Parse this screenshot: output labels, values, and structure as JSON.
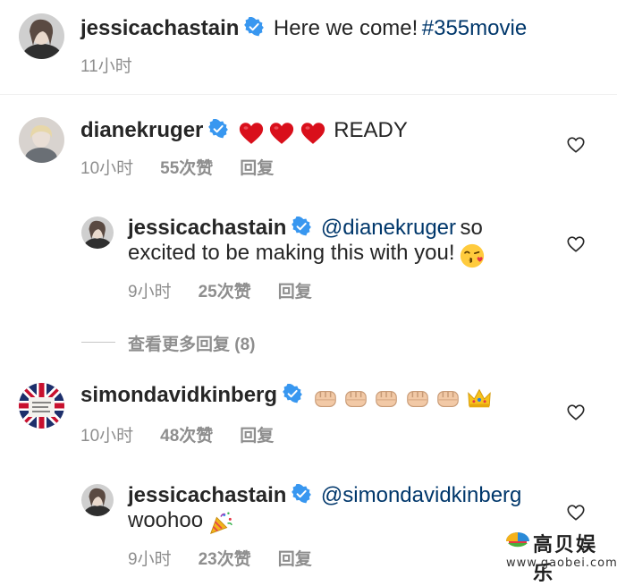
{
  "post": {
    "username": "jessicachastain",
    "caption": "Here we come!",
    "hashtag": "#355movie",
    "time": "11小时"
  },
  "comments": [
    {
      "username": "dianekruger",
      "text": "READY",
      "emojis": [
        "red-heart-icon",
        "red-heart-icon",
        "red-heart-icon"
      ],
      "time": "10小时",
      "likes": "55次赞",
      "reply_label": "回复"
    },
    {
      "username": "jessicachastain",
      "mention": "@dianekruger",
      "text_line1_rest": "so",
      "text_line2": "excited to be making this with you!",
      "emojis": [
        "face-blowing-kiss-icon"
      ],
      "time": "9小时",
      "likes": "25次赞",
      "reply_label": "回复"
    },
    {
      "username": "simondavidkinberg",
      "text": "",
      "emojis": [
        "fist-icon",
        "fist-icon",
        "fist-icon",
        "fist-icon",
        "fist-icon",
        "crown-icon"
      ],
      "time": "10小时",
      "likes": "48次赞",
      "reply_label": "回复"
    },
    {
      "username": "jessicachastain",
      "mention": "@simondavidkinberg",
      "text_line2": "woohoo",
      "emojis": [
        "party-popper-icon"
      ],
      "time": "9小时",
      "likes": "23次赞",
      "reply_label": "回复"
    }
  ],
  "view_more_replies": "查看更多回复 (8)",
  "watermark": {
    "text": "高贝娱乐",
    "url": "www.gaobei.com"
  },
  "colors": {
    "text": "#262626",
    "meta": "#8e8e8e",
    "link": "#00376b",
    "verified": "#3897f0",
    "heart": "#d90f1b"
  }
}
